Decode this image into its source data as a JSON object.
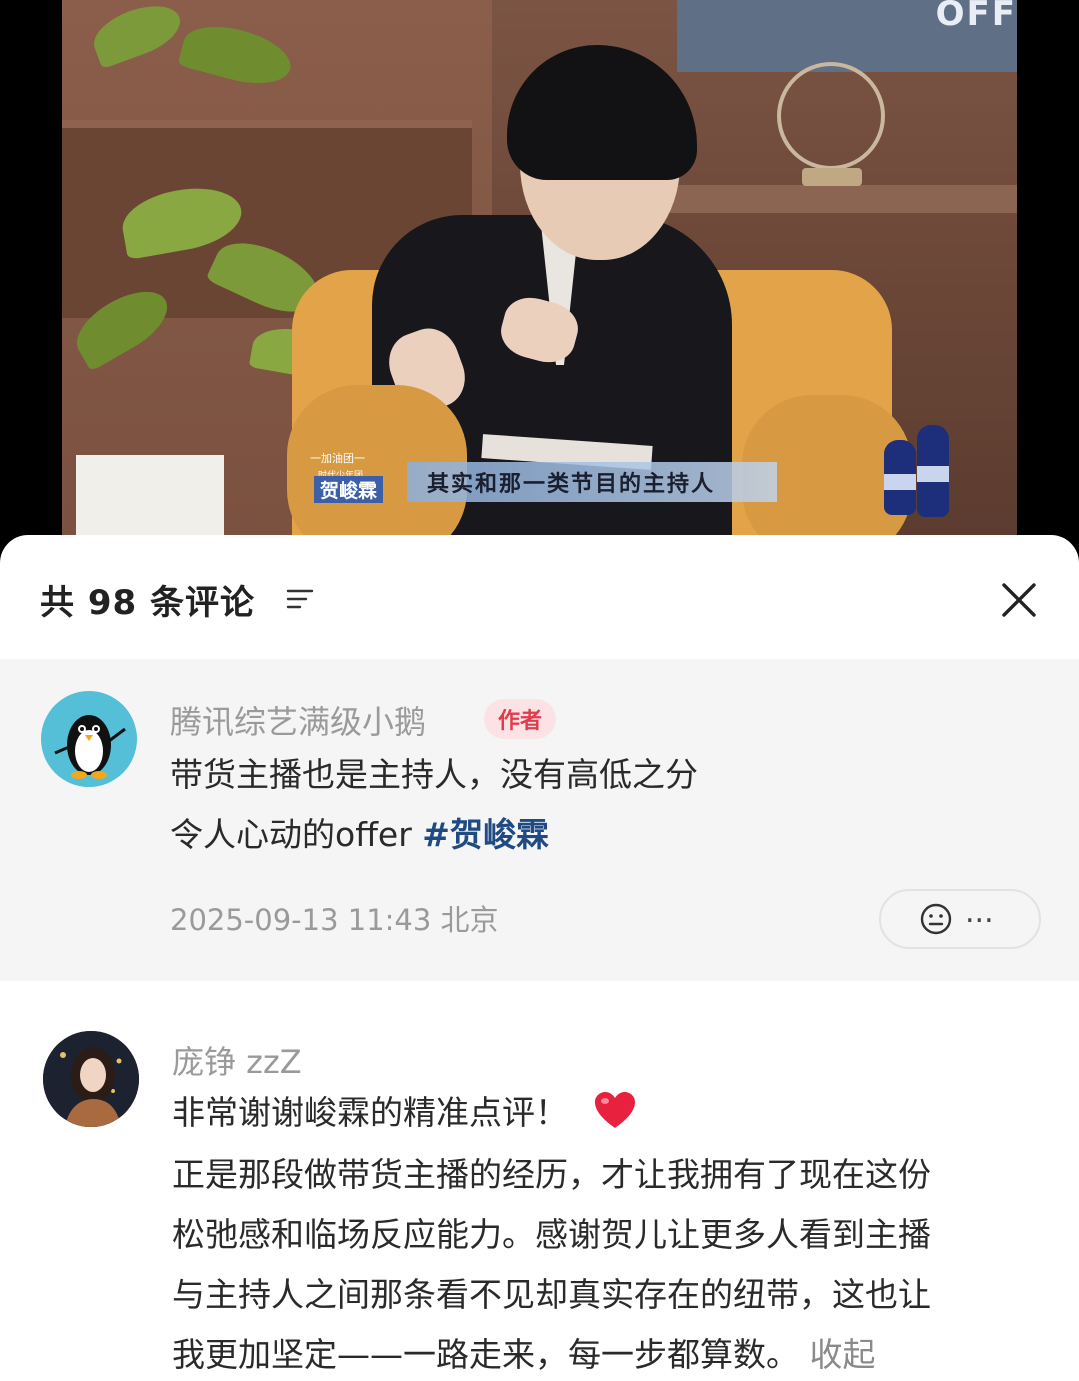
{
  "video": {
    "sign_text": "OFF",
    "tag_line1": "一加油团一",
    "tag_line2": "时代少年团",
    "tag_name": "贺峻霖",
    "subtitle": "其实和那一类节目的主持人"
  },
  "sheet": {
    "title": "共 98 条评论",
    "sort_icon": "sort-lines-icon",
    "close_icon": "close-icon"
  },
  "comments": [
    {
      "username": "腾讯综艺满级小鹅",
      "badge": "作者",
      "lines": [
        "带货主播也是主持人，没有高低之分",
        "令人心动的offer"
      ],
      "hashtag": "#贺峻霖",
      "meta": "2025-09-13 11:43 北京",
      "reaction_more": "...",
      "avatar_icon": "penguin-avatar-icon"
    },
    {
      "username": "庞铮 zzZ",
      "lines": [
        "非常谢谢峻霖的精准点评！",
        "正是那段做带货主播的经历，才让我拥有了现在这份",
        "松弛感和临场反应能力。感谢贺儿让更多人看到主播",
        "与主持人之间那条看不见却真实存在的纽带，这也让",
        "我更加坚定——一路走来，每一步都算数。"
      ],
      "collapse": "收起",
      "emoji": "red-heart-icon",
      "avatar_icon": "portrait-avatar"
    }
  ],
  "colors": {
    "hashtag": "#1f4a82",
    "badge_text": "#e23b4b",
    "badge_bg": "#fbe3e5",
    "author_bg": "#f5f5f5"
  }
}
